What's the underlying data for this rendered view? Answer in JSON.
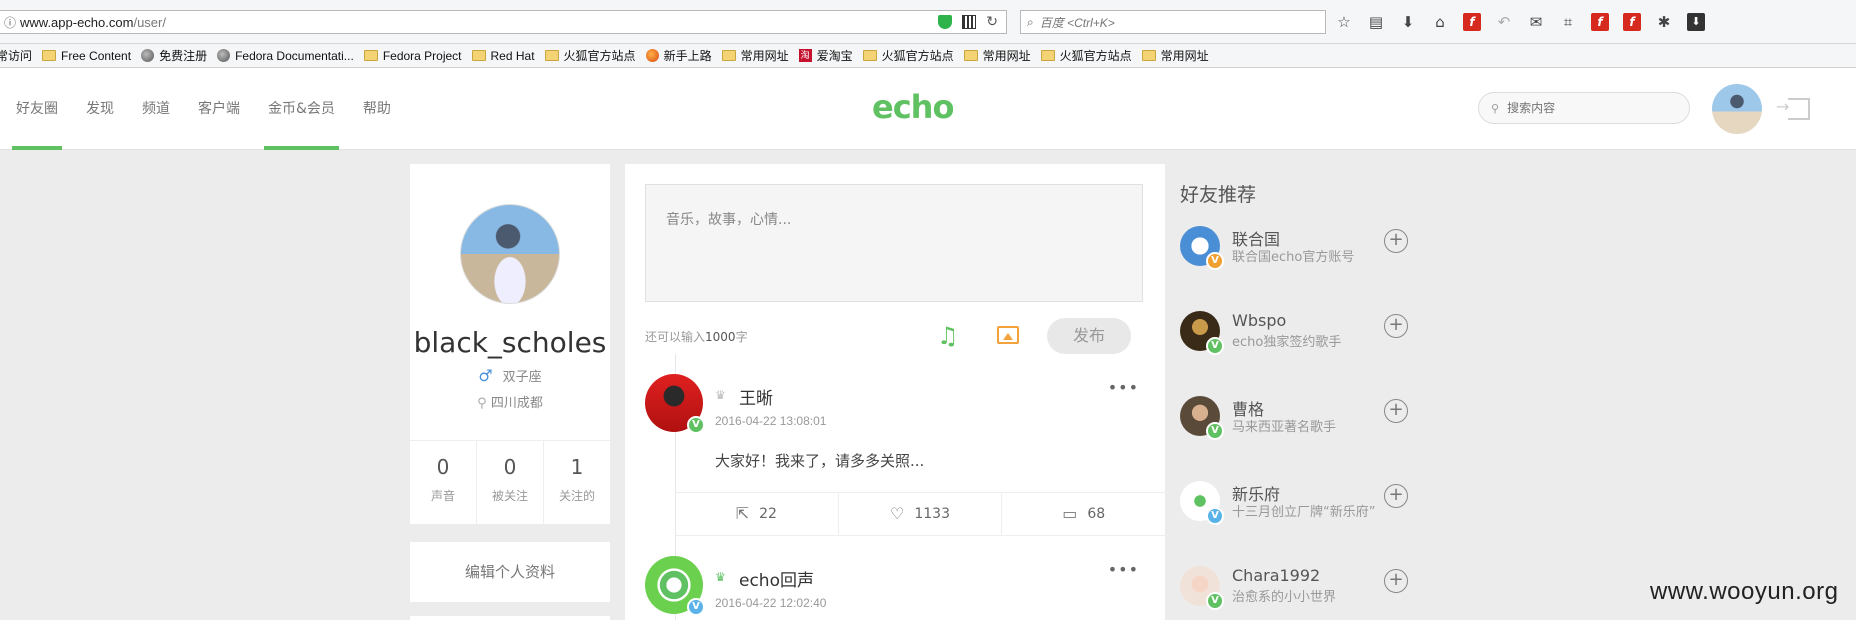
{
  "browser": {
    "url_host": "www.app-echo.com",
    "url_path": "/user/",
    "search_placeholder": "百度 <Ctrl+K>",
    "bookmarks": [
      {
        "label": "常访问",
        "icon": "folder"
      },
      {
        "label": "Free Content",
        "icon": "folder"
      },
      {
        "label": "免费注册",
        "icon": "globe"
      },
      {
        "label": "Fedora Documentati...",
        "icon": "globe"
      },
      {
        "label": "Fedora Project",
        "icon": "folder"
      },
      {
        "label": "Red Hat",
        "icon": "folder"
      },
      {
        "label": "火狐官方站点",
        "icon": "folder"
      },
      {
        "label": "新手上路",
        "icon": "firefox"
      },
      {
        "label": "常用网址",
        "icon": "folder"
      },
      {
        "label": "爱淘宝",
        "icon": "taobao"
      },
      {
        "label": "火狐官方站点",
        "icon": "folder"
      },
      {
        "label": "常用网址",
        "icon": "folder"
      },
      {
        "label": "火狐官方站点",
        "icon": "folder"
      },
      {
        "label": "常用网址",
        "icon": "folder"
      }
    ]
  },
  "header": {
    "nav": [
      "好友圈",
      "发现",
      "频道",
      "客户端",
      "金币&会员",
      "帮助"
    ],
    "logo": "echo",
    "search_placeholder": "搜索内容"
  },
  "profile": {
    "name": "black_scholes",
    "sign": "双子座",
    "location": "四川成都",
    "stats": [
      {
        "num": "0",
        "label": "声音"
      },
      {
        "num": "0",
        "label": "被关注"
      },
      {
        "num": "1",
        "label": "关注的"
      }
    ],
    "edit_label": "编辑个人资料"
  },
  "composer": {
    "placeholder": "音乐，故事，心情...",
    "remain_prefix": "还可以输入",
    "remain_num": "1000",
    "remain_suffix": "字",
    "publish_label": "发布"
  },
  "posts": [
    {
      "name": "王晰",
      "time": "2016-04-22 13:08:01",
      "text": "大家好！我来了，请多多关照...",
      "share": "22",
      "like": "1133",
      "comment": "68",
      "badge": "V"
    },
    {
      "name": "echo回声",
      "time": "2016-04-22 12:02:40",
      "badge": "V"
    }
  ],
  "friends": {
    "title": "好友推荐",
    "items": [
      {
        "name": "联合国",
        "desc": "联合国echo官方账号",
        "badge": "V"
      },
      {
        "name": "Wbspo",
        "desc": "echo独家签约歌手",
        "badge": "V"
      },
      {
        "name": "曹格",
        "desc": "马来西亚著名歌手",
        "badge": "V"
      },
      {
        "name": "新乐府",
        "desc": "十三月创立厂牌“新乐府”",
        "badge": "V"
      },
      {
        "name": "Chara1992",
        "desc": "治愈系的小小世界",
        "badge": "V"
      }
    ],
    "follow_symbol": "+"
  },
  "watermark": "www.wooyun.org"
}
